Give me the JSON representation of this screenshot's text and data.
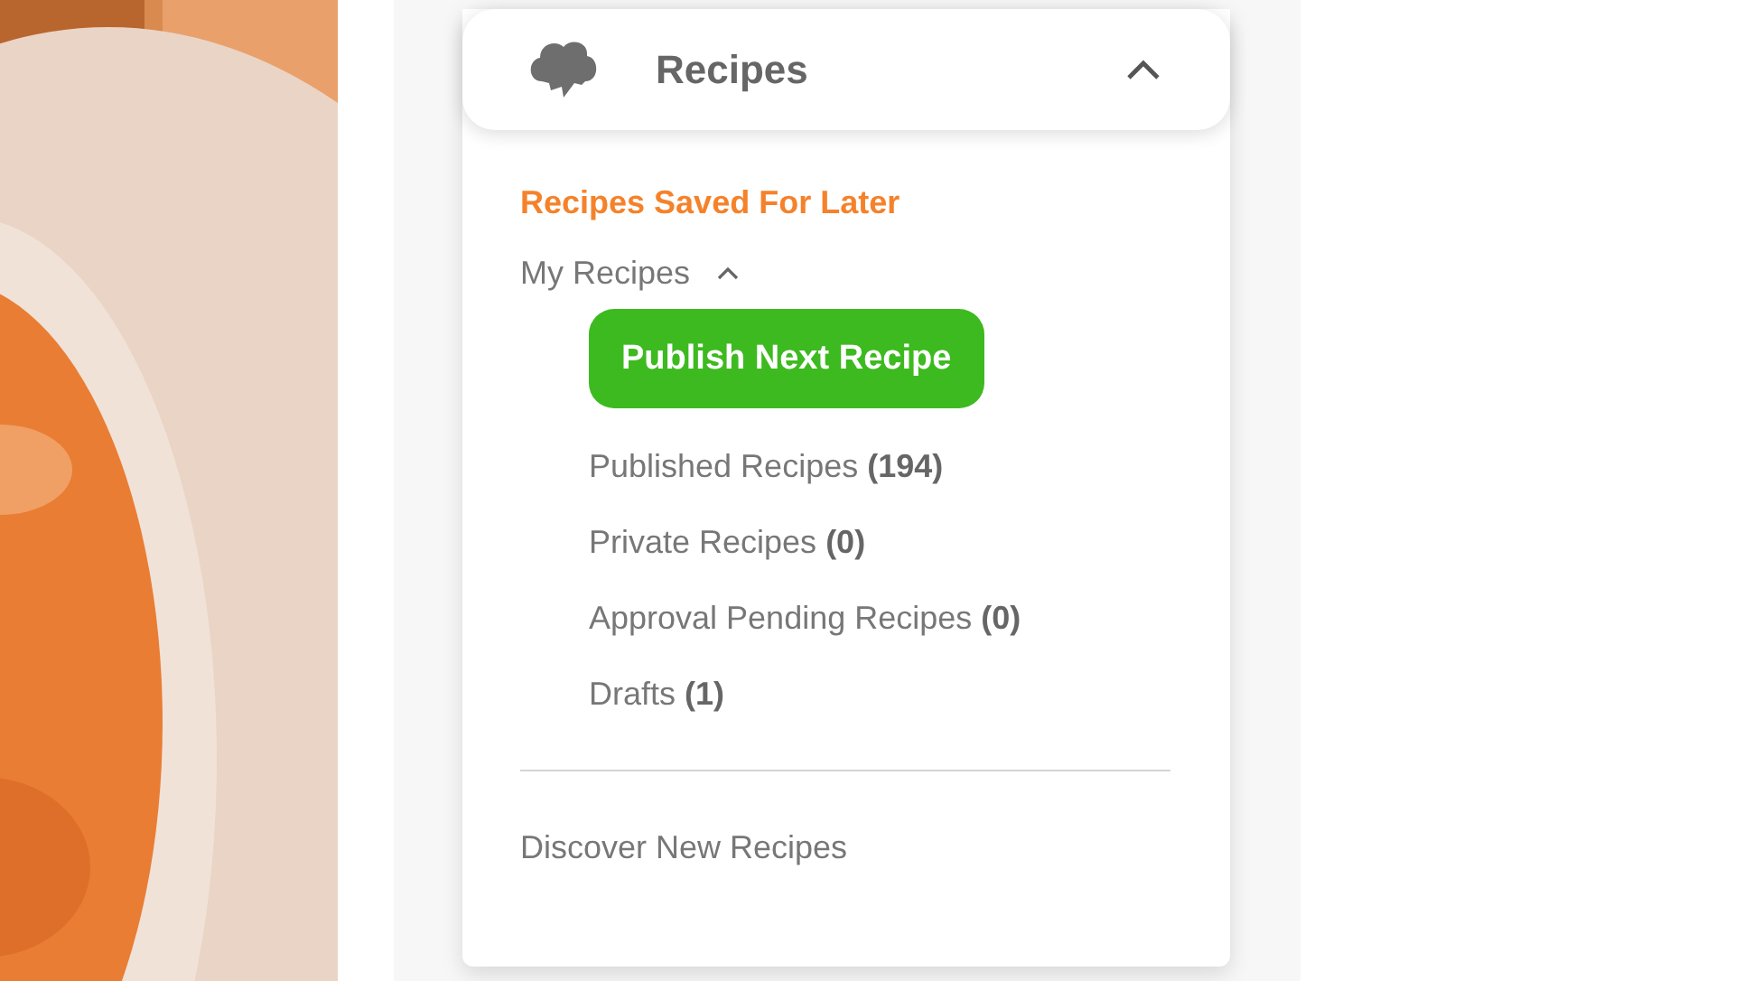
{
  "menu": {
    "title": "Recipes",
    "expanded": true,
    "items": [
      {
        "kind": "link",
        "label": "Recipes Saved For Later",
        "highlighted": true
      },
      {
        "kind": "group",
        "label": "My Recipes",
        "expanded": true,
        "children": [
          {
            "kind": "button",
            "label": "Publish Next Recipe"
          },
          {
            "kind": "link",
            "label": "Published Recipes **(194)**",
            "highlighted": false
          },
          {
            "kind": "link",
            "label": "Private Recipes **(0)**",
            "highlighted": false
          },
          {
            "kind": "link",
            "label": "Approval Pending Recipes **(0)**",
            "highlighted": false
          },
          {
            "kind": "link",
            "label": "Drafts **(1)**",
            "highlighted": false
          }
        ]
      }
    ],
    "footer_items": [
      {
        "kind": "link",
        "label": "Discover New Recipes",
        "highlighted": false
      }
    ]
  }
}
